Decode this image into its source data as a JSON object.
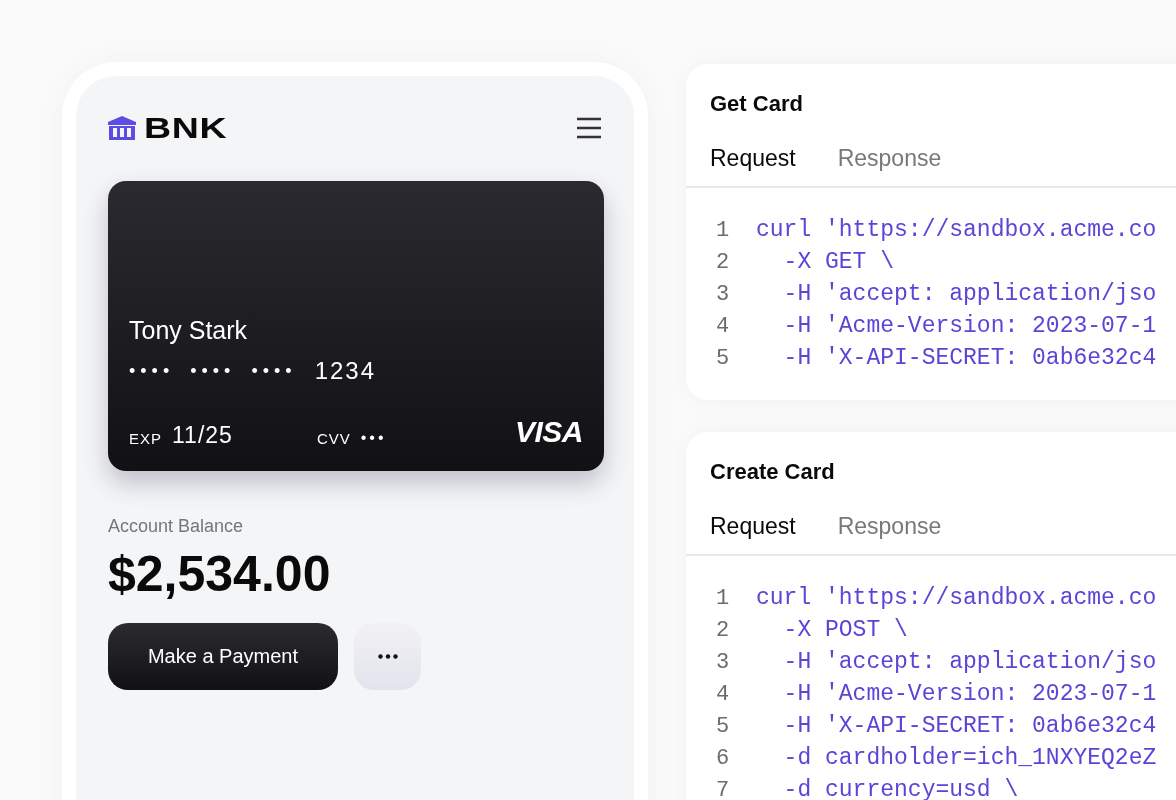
{
  "phone": {
    "brand": "BNK",
    "card": {
      "holder": "Tony Stark",
      "number_mask": "•••• •••• ••••",
      "last4": "1234",
      "exp_label": "EXP",
      "exp": "11/25",
      "cvv_label": "CVV",
      "cvv": "•••",
      "network": "VISA"
    },
    "balance_label": "Account Balance",
    "balance": "$2,534.00",
    "primary_button": "Make a Payment"
  },
  "endpoints": [
    {
      "title": "Get Card",
      "tabs": [
        {
          "label": "Request",
          "selected": true
        },
        {
          "label": "Response",
          "selected": false
        }
      ],
      "code": [
        {
          "number": "1",
          "text": "curl 'https://sandbox.acme.co"
        },
        {
          "number": "2",
          "text": "  -X GET \\"
        },
        {
          "number": "3",
          "text": "  -H 'accept: application/jso"
        },
        {
          "number": "4",
          "text": "  -H 'Acme-Version: 2023-07-1"
        },
        {
          "number": "5",
          "text": "  -H 'X-API-SECRET: 0ab6e32c4"
        }
      ]
    },
    {
      "title": "Create Card",
      "tabs": [
        {
          "label": "Request",
          "selected": true
        },
        {
          "label": "Response",
          "selected": false
        }
      ],
      "code": [
        {
          "number": "1",
          "text": "curl 'https://sandbox.acme.co"
        },
        {
          "number": "2",
          "text": "  -X POST \\"
        },
        {
          "number": "3",
          "text": "  -H 'accept: application/jso"
        },
        {
          "number": "4",
          "text": "  -H 'Acme-Version: 2023-07-1"
        },
        {
          "number": "5",
          "text": "  -H 'X-API-SECRET: 0ab6e32c4"
        },
        {
          "number": "6",
          "text": "  -d cardholder=ich_1NXYEQ2eZ"
        },
        {
          "number": "7",
          "text": "  -d currency=usd \\"
        }
      ]
    }
  ]
}
